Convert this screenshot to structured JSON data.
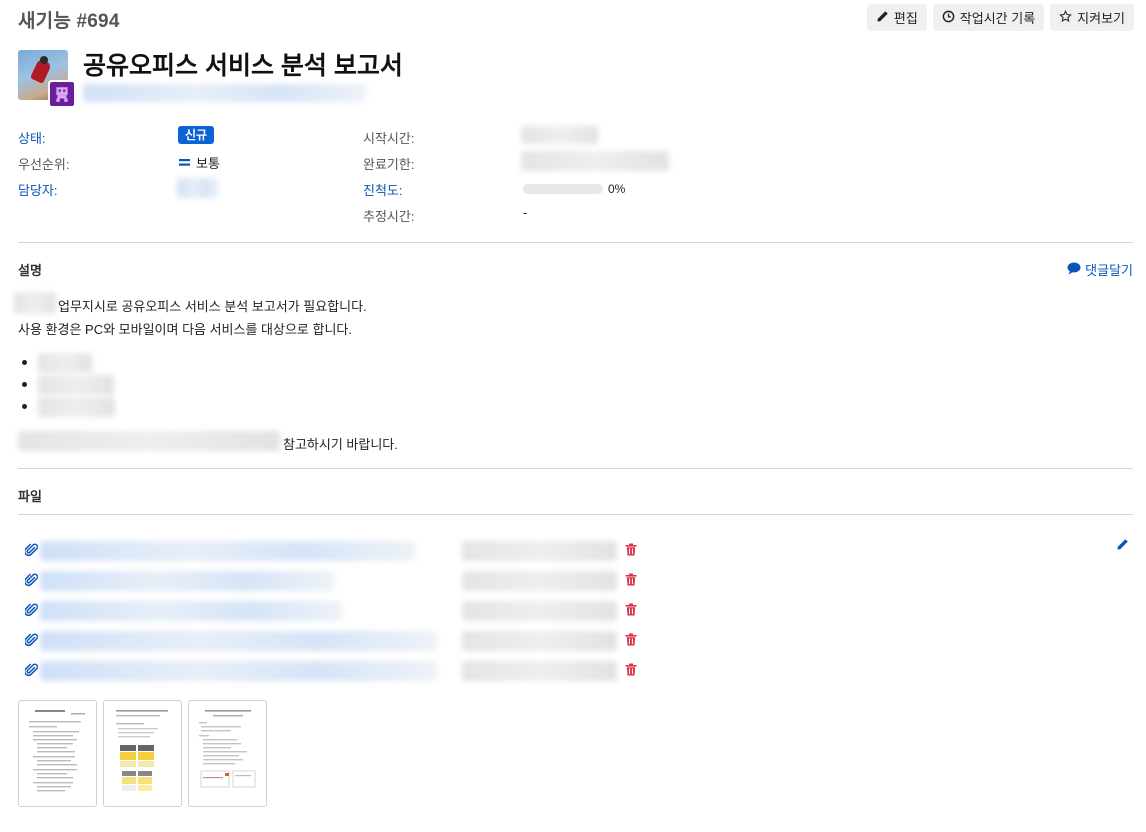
{
  "header": {
    "issue_id": "새기능 #694",
    "edit_label": "편집",
    "log_time_label": "작업시간 기록",
    "watch_label": "지켜보기"
  },
  "issue": {
    "title": "공유오피스 서비스 분석 보고서"
  },
  "attributes": {
    "status_label": "상태:",
    "status_value": "신규",
    "priority_label": "우선순위:",
    "priority_value": "보통",
    "assignee_label": "담당자:",
    "start_label": "시작시간:",
    "due_label": "완료기한:",
    "progress_label": "진척도:",
    "progress_percent": 0,
    "progress_text": "0%",
    "estimate_label": "추정시간:",
    "estimate_value": "-"
  },
  "description": {
    "section_title": "설명",
    "comment_link": "댓글달기",
    "line1_suffix": "업무지시로 공유오피스 서비스 분석 보고서가 필요합니다.",
    "line2": "사용 환경은 PC와 모바일이며 다음 서비스를 대상으로 합니다.",
    "closing_suffix": "참고하시기 바랍니다."
  },
  "files": {
    "section_title": "파일",
    "count": 5,
    "thumbnail_count": 3
  },
  "colors": {
    "link_blue": "#0a55b8",
    "badge_blue": "#0b63d6",
    "delete_red": "#d9354a"
  }
}
